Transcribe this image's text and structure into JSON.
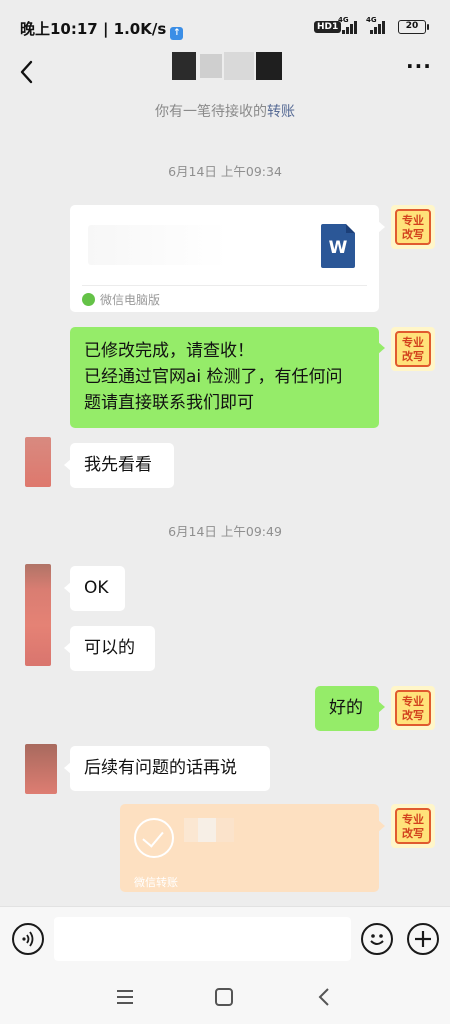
{
  "status_bar": {
    "time": "晚上10:17 | 1.0K/s",
    "hd_badge": "HD1",
    "network_1": "4G",
    "network_2": "4G",
    "battery": "20"
  },
  "nav": {
    "back_icon": "chevron-left-icon",
    "more_icon": "more-horizontal-icon"
  },
  "tip": {
    "text": "你有一笔待接收的",
    "link": "转账"
  },
  "avatar_self_text_line1": "专业",
  "avatar_self_text_line2": "改写",
  "messages": {
    "time1": "6月14日 上午09:34",
    "file": {
      "icon_letter": "W",
      "source": "微信电脑版"
    },
    "msg_done": {
      "line1": "已修改完成，请查收！",
      "line2": "已经通过官网ai 检测了，有任何问",
      "line3": "题请直接联系我们即可"
    },
    "msg_look": "我先看看",
    "time2": "6月14日 上午09:49",
    "msg_ok": "OK",
    "msg_fine": "可以的",
    "msg_good": "好的",
    "msg_later": "后续有问题的话再说",
    "transfer": {
      "label": "微信转账"
    }
  },
  "colors": {
    "green_bubble": "#95ec69",
    "link": "#576b95",
    "transfer_card": "#fde0c1"
  }
}
